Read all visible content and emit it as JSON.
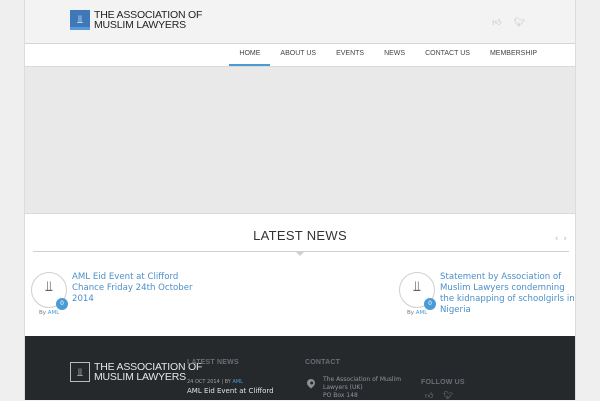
{
  "header": {
    "logo_mark": "⫫",
    "logo_line1": "The Association of",
    "logo_line2": "Muslim Lawyers",
    "social_icons": [
      "thumbs-up-icon",
      "twitter-icon"
    ]
  },
  "nav": {
    "items": [
      {
        "label": "HOME",
        "active": true
      },
      {
        "label": "ABOUT US",
        "active": false
      },
      {
        "label": "EVENTS",
        "active": false
      },
      {
        "label": "NEWS",
        "active": false
      },
      {
        "label": "CONTACT US",
        "active": false
      },
      {
        "label": "MEMBERSHIP",
        "active": false
      }
    ]
  },
  "latest_news": {
    "title": "LATEST NEWS",
    "prev": "‹",
    "next": "›",
    "items": [
      {
        "title": "AML Eid Event at Clifford Chance Friday 24th October 2014",
        "comments": "0",
        "by_label": "By",
        "author": "AML"
      },
      {
        "title": "Statement by Association of Muslim Lawyers condemning the kidnapping of schoolgirls in Nigeria",
        "comments": "0",
        "by_label": "By",
        "author": "AML"
      }
    ]
  },
  "footer": {
    "logo_line1": "The Association of",
    "logo_line2": "Muslim Lawyers",
    "latest_news_heading": "LATEST NEWS",
    "news_date": "24 OCT 2014",
    "news_separator": "| BY",
    "news_author": "AML",
    "news_title": "AML Eid Event at Clifford",
    "contact_heading": "CONTACT",
    "contact_line1": "The Association of Muslim",
    "contact_line2": "Lawyers (UK)",
    "contact_line3": "PO Box 148",
    "follow_heading": "FOLLOW US"
  },
  "colors": {
    "accent": "#4b9ad5",
    "footer_bg": "#26292c",
    "link": "#4b8fc9"
  }
}
